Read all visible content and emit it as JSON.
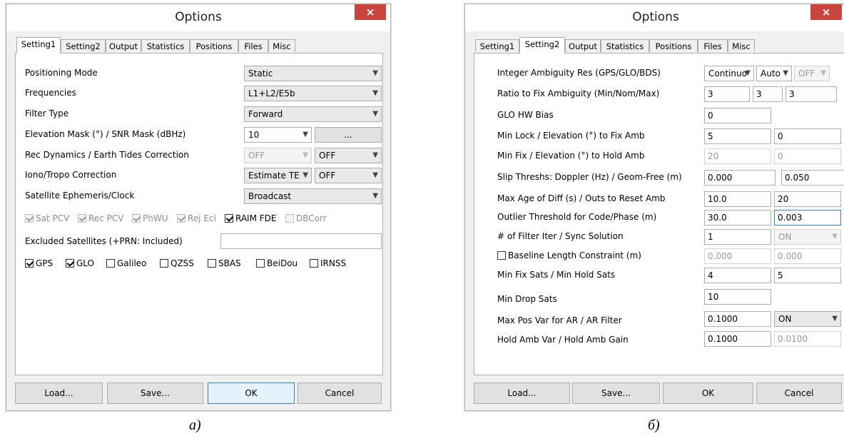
{
  "dialog_a": {
    "title": "Options",
    "close": "×",
    "tabs": [
      "Setting1",
      "Setting2",
      "Output",
      "Statistics",
      "Positions",
      "Files",
      "Misc"
    ],
    "rows": {
      "positioning_mode": {
        "label": "Positioning Mode",
        "value": "Static"
      },
      "frequencies": {
        "label": "Frequencies",
        "value": "L1+L2/E5b"
      },
      "filter_type": {
        "label": "Filter Type",
        "value": "Forward"
      },
      "elevation_mask": {
        "label": "Elevation Mask (°) / SNR Mask (dBHz)",
        "value": "10",
        "button": "..."
      },
      "rec_dynamics": {
        "label": "Rec Dynamics / Earth Tides Correction",
        "value1": "OFF",
        "value2": "OFF"
      },
      "iono_tropo": {
        "label": "Iono/Tropo Correction",
        "value1": "Estimate TE",
        "value2": "OFF"
      },
      "ephemeris": {
        "label": "Satellite Ephemeris/Clock",
        "value": "Broadcast"
      }
    },
    "options_checks": [
      {
        "label": "Sat PCV",
        "checked": true,
        "enabled": false
      },
      {
        "label": "Rec PCV",
        "checked": true,
        "enabled": false
      },
      {
        "label": "PhWU",
        "checked": true,
        "enabled": false
      },
      {
        "label": "Rej Ecl",
        "checked": true,
        "enabled": false
      },
      {
        "label": "RAIM FDE",
        "checked": true,
        "enabled": true
      },
      {
        "label": "DBCorr",
        "checked": false,
        "enabled": false
      }
    ],
    "excluded_label": "Excluded Satellites (+PRN: Included)",
    "excluded_value": "",
    "systems": [
      {
        "label": "GPS",
        "checked": true
      },
      {
        "label": "GLO",
        "checked": true
      },
      {
        "label": "Galileo",
        "checked": false
      },
      {
        "label": "QZSS",
        "checked": false
      },
      {
        "label": "SBAS",
        "checked": false
      },
      {
        "label": "BeiDou",
        "checked": false
      },
      {
        "label": "IRNSS",
        "checked": false
      }
    ],
    "buttons": {
      "load": "Load...",
      "save": "Save...",
      "ok": "OK",
      "cancel": "Cancel"
    },
    "caption": "а)"
  },
  "dialog_b": {
    "title": "Options",
    "close": "×",
    "tabs": [
      "Setting1",
      "Setting2",
      "Output",
      "Statistics",
      "Positions",
      "Files",
      "Misc"
    ],
    "rows": {
      "ambiguity_res": {
        "label": "Integer Ambiguity Res (GPS/GLO/BDS)",
        "value1": "Continuo",
        "value2": "Auto",
        "value3": "OFF"
      },
      "ratio_fix": {
        "label": "Ratio to Fix Ambiguity (Min/Nom/Max)",
        "value1": "3",
        "value2": "3",
        "value3": "3"
      },
      "glo_hw_bias": {
        "label": "GLO HW Bias",
        "value": "0"
      },
      "min_lock": {
        "label": "Min Lock / Elevation (°) to Fix Amb",
        "value1": "5",
        "value2": "0"
      },
      "min_fix": {
        "label": "Min Fix / Elevation (°) to Hold Amb",
        "value1": "20",
        "value2": "0"
      },
      "slip_thresh": {
        "label": "Slip Threshs: Doppler (Hz) / Geom-Free (m)",
        "value1": "0.000",
        "value2": "0.050"
      },
      "max_age": {
        "label": "Max Age of Diff (s) / Outs to Reset Amb",
        "value1": "10.0",
        "value2": "20"
      },
      "outlier": {
        "label": "Outlier Threshold for Code/Phase (m)",
        "value1": "30.0",
        "value2": "0.003"
      },
      "filter_iter": {
        "label": "# of Filter Iter / Sync Solution",
        "value1": "1",
        "value2": "ON"
      },
      "baseline": {
        "label": "Baseline Length Constraint (m)",
        "value1": "0.000",
        "value2": "0.000"
      },
      "min_sats": {
        "label": "Min Fix Sats / Min Hold Sats",
        "value1": "4",
        "value2": "5"
      },
      "min_drop": {
        "label": "Min Drop Sats",
        "value": "10"
      },
      "max_pos_var": {
        "label": "Max Pos Var for AR / AR Filter",
        "value1": "0.1000",
        "value2": "ON"
      },
      "hold_amb": {
        "label": "Hold Amb Var / Hold Amb Gain",
        "value1": "0.1000",
        "value2": "0.0100"
      }
    },
    "buttons": {
      "load": "Load...",
      "save": "Save...",
      "ok": "OK",
      "cancel": "Cancel"
    },
    "caption": "б)"
  }
}
